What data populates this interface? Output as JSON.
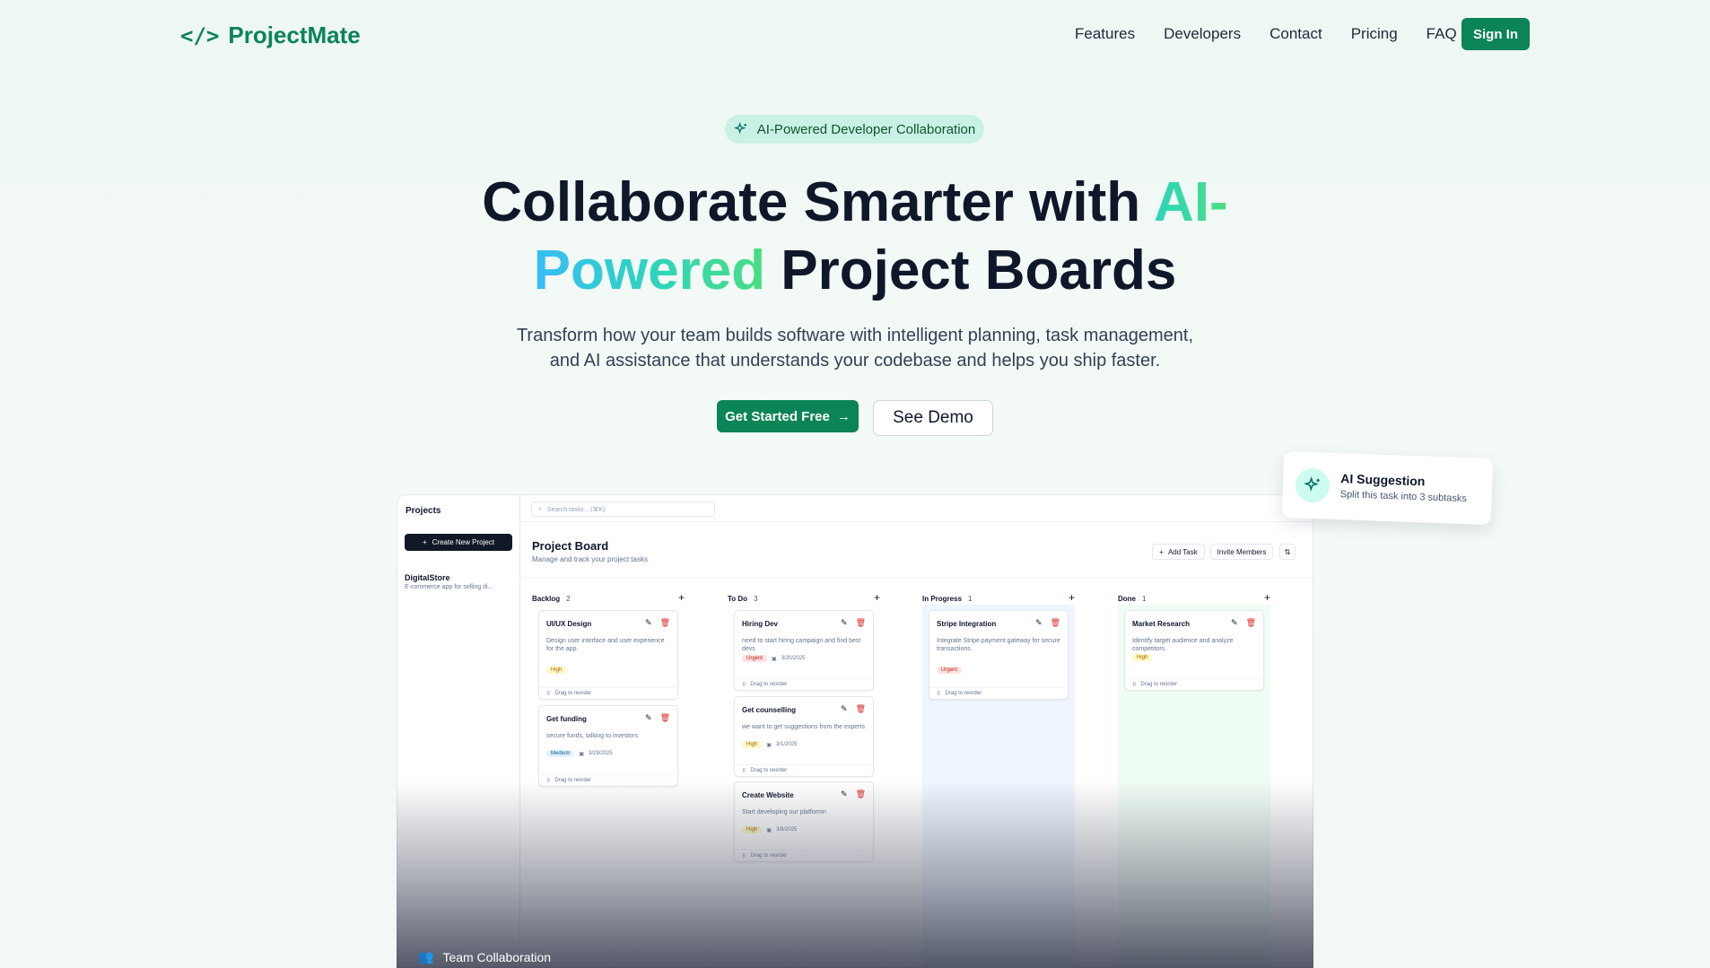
{
  "nav": {
    "brand": "ProjectMate",
    "links": [
      "Features",
      "Developers",
      "Contact",
      "Pricing",
      "FAQ"
    ],
    "signin": "Sign In"
  },
  "hero": {
    "pill": "AI-Powered Developer Collaboration",
    "title_line1_a": "Collaborate Smarter with ",
    "title_line1_b": "AI-",
    "title_line2_a": "Powered",
    "title_line2_b": " Project Boards",
    "subtitle_line1": "Transform how your team builds software with intelligent planning, task management,",
    "subtitle_line2": "and AI assistance that understands your codebase and helps you ship faster.",
    "cta_primary": "Get Started Free",
    "cta_secondary": "See Demo"
  },
  "app": {
    "sidebar": {
      "title": "Projects",
      "create": "Create New Project",
      "project_name": "DigitalStore",
      "project_desc": "E-commerce app for selling di..."
    },
    "search_placeholder": "Search tasks... (⌘K)",
    "board_title": "Project Board",
    "board_subtitle": "Manage and track your project tasks",
    "add_task": "Add Task",
    "invite": "Invite Members",
    "drag_label": "Drag to reorder",
    "columns": [
      {
        "name": "Backlog",
        "count": "2",
        "cards": [
          {
            "title": "UI/UX Design",
            "desc": "Design user interface and user experience for the app.",
            "priority": "High",
            "date": ""
          },
          {
            "title": "Get funding",
            "desc": "secure funds, talking to investors",
            "priority": "Medium",
            "date": "3/29/2025"
          }
        ]
      },
      {
        "name": "To Do",
        "count": "3",
        "cards": [
          {
            "title": "Hiring Dev",
            "desc": "need to start hiring campaign and find best devs",
            "priority": "Urgent",
            "date": "3/20/2025"
          },
          {
            "title": "Get counselling",
            "desc": "we want to get suggestions from the experts",
            "priority": "High",
            "date": "3/1/2025"
          },
          {
            "title": "Create Website",
            "desc": "Start developing our platformn",
            "priority": "High",
            "date": "3/8/2025"
          }
        ]
      },
      {
        "name": "In Progress",
        "count": "1",
        "cards": [
          {
            "title": "Stripe Integration",
            "desc": "Integrate Stripe payment gateway for secure transactions.",
            "priority": "Urgent",
            "date": ""
          }
        ]
      },
      {
        "name": "Done",
        "count": "1",
        "cards": [
          {
            "title": "Market Research",
            "desc": "Identify target audience and analyze competitors.",
            "priority": "High",
            "date": ""
          }
        ]
      }
    ]
  },
  "ai_suggestion": {
    "title": "AI Suggestion",
    "desc": "Split this task into 3 subtasks"
  },
  "team_label": "Team Collaboration",
  "colors": {
    "brand": "#0b8457",
    "gradient_start": "#2dd4bf",
    "gradient_end": "#4ade80"
  }
}
